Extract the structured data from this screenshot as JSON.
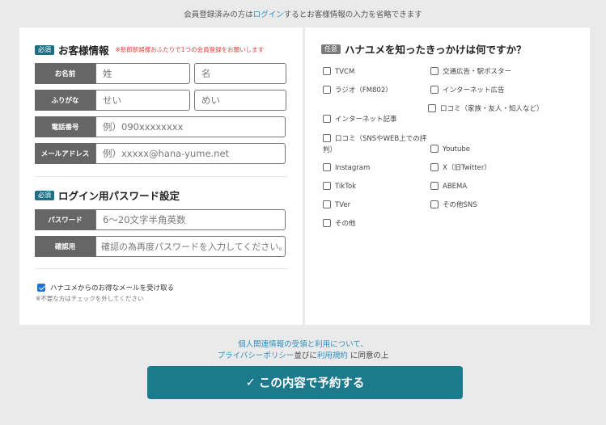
{
  "top_note": {
    "prefix": "会員登録済みの方は",
    "link": "ログイン",
    "suffix": "するとお客様情報の入力を省略できます"
  },
  "customer": {
    "badge": "必須",
    "title": "お客様情報",
    "note": "※新郎新婦様おふたりで1つの会員登録をお願いします",
    "rows": [
      {
        "label": "お名前",
        "first": "姓",
        "second": "名"
      },
      {
        "label": "ふりがな",
        "first": "せい",
        "second": "めい"
      },
      {
        "label": "電話番号",
        "placeholder": "例）090xxxxxxxx"
      },
      {
        "label": "メールアドレス",
        "placeholder": "例）xxxxx@hana-yume.net"
      }
    ]
  },
  "password": {
    "badge": "必須",
    "title": "ログイン用パスワード設定",
    "rows": [
      {
        "label": "パスワード",
        "placeholder": "6〜20文字半角英数"
      },
      {
        "label": "確認用",
        "placeholder": "確認の為再度パスワードを入力してください。"
      }
    ]
  },
  "optin": {
    "label": "ハナユメからのお得なメールを受け取る",
    "checked": true,
    "note": "※不要な方はチェックを外してください"
  },
  "survey": {
    "badge": "任意",
    "title": "ハナユメを知ったきっかけは何ですか？",
    "options": [
      "TVCM",
      "交通広告・駅ポスター",
      "ラジオ（FM802）",
      "インターネット広告",
      "インターネット記事",
      "口コミ（家族・友人・知人など）",
      "口コミ（SNSやWEB上での評判）",
      "Youtube",
      "Instagram",
      "X（旧Twitter）",
      "TikTok",
      "ABEMA",
      "TVer",
      "その他SNS",
      "その他"
    ]
  },
  "privacy": {
    "line1": "個人関連情報の受領と利用について、",
    "policy_link": "プライバシーポリシー",
    "mid": "並びに",
    "terms_link": "利用規約",
    "suffix": " に同意の上"
  },
  "submit": {
    "check": "✓",
    "label": "この内容で予約する"
  },
  "colors": {
    "primary": "#1c7a8c",
    "link": "#2b8fbf",
    "required_badge": "#1c6f84",
    "optional_badge": "#7a7a7a",
    "label_bg": "#666666",
    "note_red": "#e23c3c"
  }
}
